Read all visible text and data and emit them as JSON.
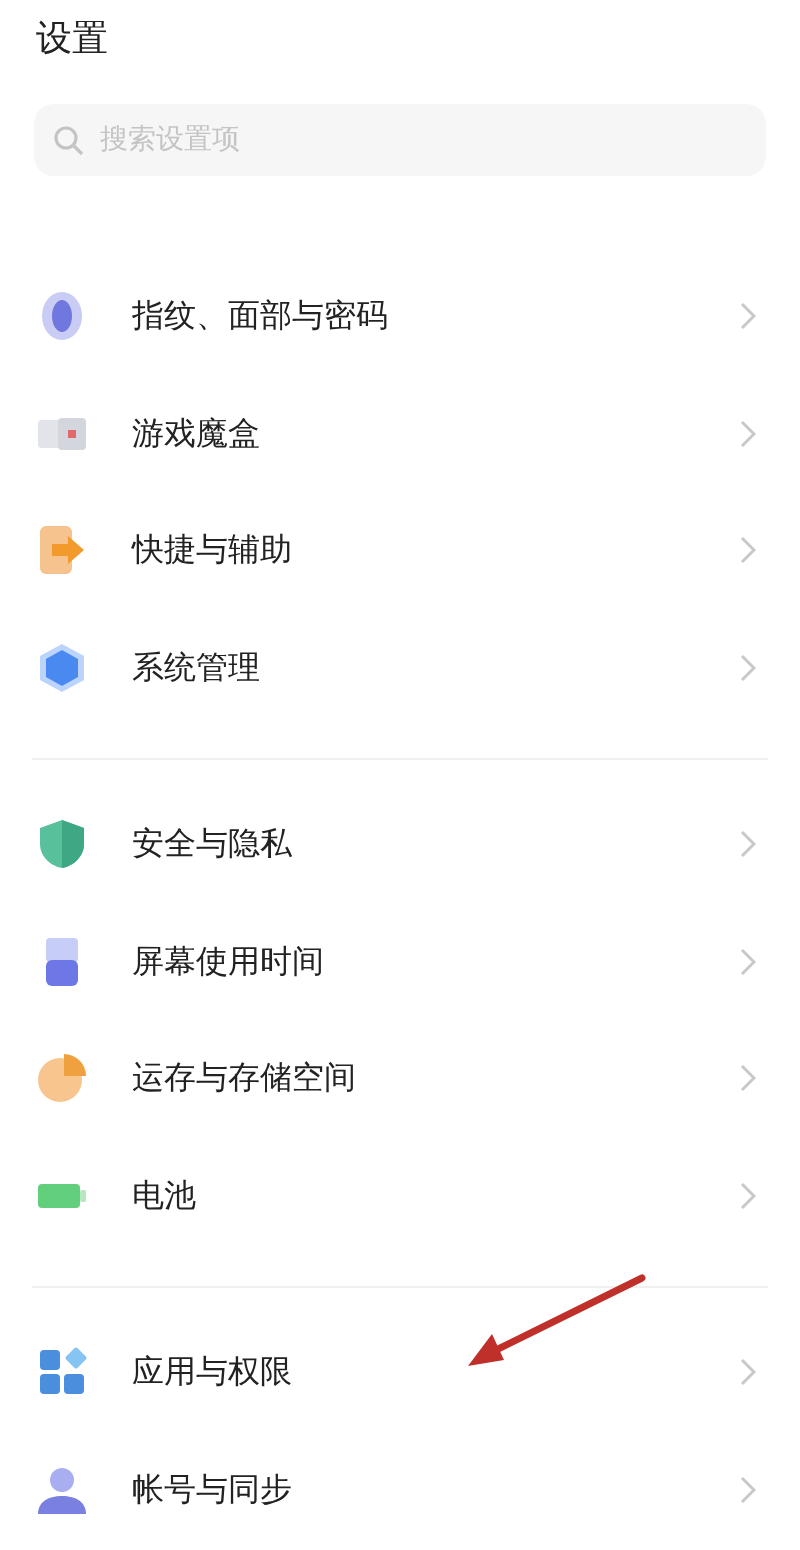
{
  "title": "设置",
  "search": {
    "placeholder": "搜索设置项"
  },
  "groups": [
    {
      "items": [
        {
          "label": "指纹、面部与密码",
          "kind": "fingerprint"
        },
        {
          "label": "游戏魔盒",
          "kind": "game"
        },
        {
          "label": "快捷与辅助",
          "kind": "shortcut"
        },
        {
          "label": "系统管理",
          "kind": "system"
        }
      ]
    },
    {
      "items": [
        {
          "label": "安全与隐私",
          "kind": "shield"
        },
        {
          "label": "屏幕使用时间",
          "kind": "hourglass"
        },
        {
          "label": "运存与存储空间",
          "kind": "storage"
        },
        {
          "label": "电池",
          "kind": "battery"
        }
      ]
    },
    {
      "items": [
        {
          "label": "应用与权限",
          "kind": "apps"
        },
        {
          "label": "帐号与同步",
          "kind": "account"
        }
      ]
    }
  ],
  "annotation": {
    "kind": "arrow"
  }
}
